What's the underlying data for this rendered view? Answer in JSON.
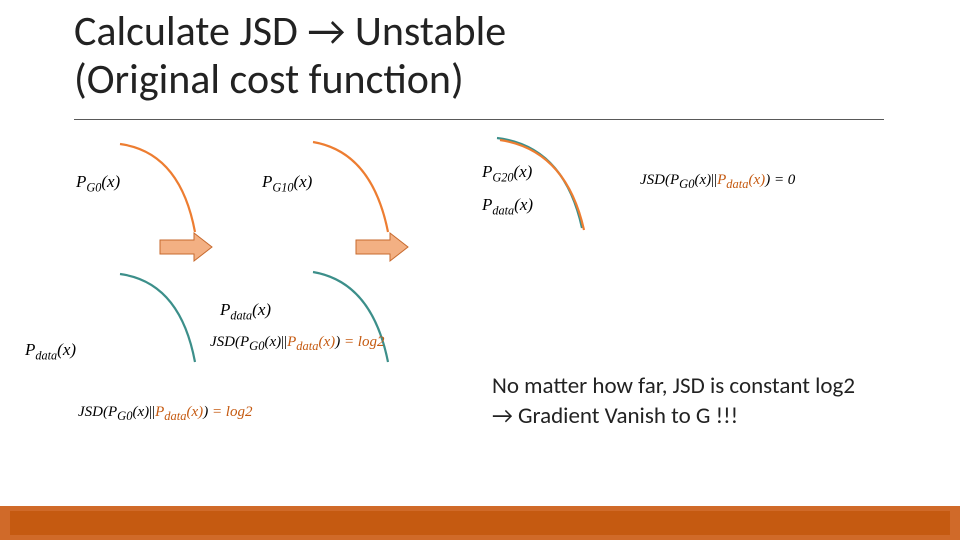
{
  "title_line1": "Calculate JSD → Unstable",
  "title_line2": "(Original cost function)",
  "labels": {
    "pg0": "P_{G0}(x)",
    "pg10": "P_{G10}(x)",
    "pg20": "P_{G20}(x)",
    "pdata": "P_{data}(x)"
  },
  "equations": {
    "jsd_zero": "JSD(P_{G0}(x)||P_{data}(x)) = 0",
    "jsd_log2_a": "JSD(P_{G0}(x)||P_{data}(x)) = log2",
    "jsd_log2_b": "JSD(P_{G0}(x)||P_{data}(x)) = log2"
  },
  "bottom_text_line1": "No matter how far, JSD is constant log2",
  "bottom_text_line2": "→ Gradient Vanish to G !!!",
  "colors": {
    "arc_orange": "#ed7d31",
    "arc_teal": "#3c8f8a",
    "arrow_fill": "#f3b083",
    "arrow_stroke": "#c76a2e",
    "accent_text": "#c55a11",
    "bar_outer": "#d06a29",
    "bar_inner": "#c55a11"
  }
}
